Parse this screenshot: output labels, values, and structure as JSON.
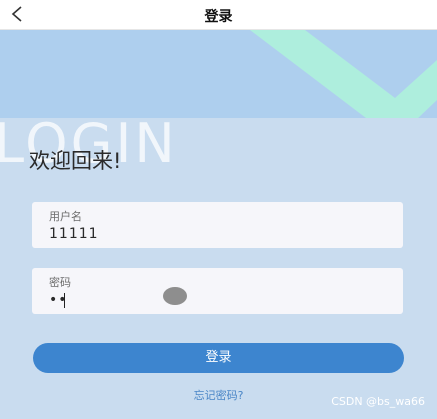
{
  "nav": {
    "title": "登录",
    "back_icon": "chevron-left-icon"
  },
  "hero": {
    "watermark": "LOGIN"
  },
  "welcome": "欢迎回来!",
  "username": {
    "label": "用户名",
    "value": "11111"
  },
  "password": {
    "label": "密码",
    "value": "••"
  },
  "login_button": "登录",
  "forgot_link": "忘记密码?",
  "credit": "CSDN @bs_wa66",
  "colors": {
    "page_bg": "#c9dcef",
    "hero_bg": "#aecfee",
    "accent_mint": "#aeeedd",
    "button": "#3d85cf",
    "link": "#4a86c7"
  }
}
